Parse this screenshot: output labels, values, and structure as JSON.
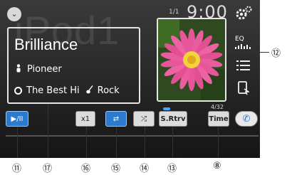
{
  "source_title": "iPod1",
  "track": {
    "title": "Brilliance",
    "artist": "Pioneer",
    "album": "The Best Hi",
    "genre": "Rock"
  },
  "status": {
    "track_counter": "1/1",
    "clock": "9:00",
    "playlist_position": "4/32"
  },
  "icons": {
    "collapse": "chevron-down-icon",
    "settings": "gear-icon",
    "eq": "equalizer-icon",
    "list": "list-icon",
    "device": "device-icon",
    "phone": "phone-icon",
    "artist": "person-icon",
    "album": "disc-icon",
    "genre": "guitar-icon"
  },
  "controls": {
    "play_pause": "▶/II",
    "speed": "x1",
    "repeat": "⇄",
    "shuffle": "⤮",
    "sound_retriever": "S.Rtrv",
    "time": "Time"
  },
  "eq_label": "EQ",
  "callouts": [
    "⑪",
    "⑰",
    "⑯",
    "⑮",
    "⑭",
    "⑬",
    "⑧",
    "⑫"
  ],
  "colors": {
    "accent": "#2a7ad0",
    "background": "#2a2a2a",
    "frame": "#e6e6e6"
  }
}
